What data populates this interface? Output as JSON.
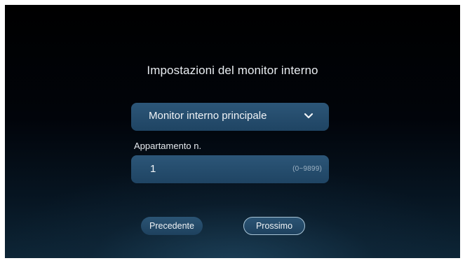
{
  "screen": {
    "title": "Impostazioni del monitor interno"
  },
  "monitor_type": {
    "selected": "Monitor interno principale",
    "icon": "chevron-down-icon"
  },
  "apartment": {
    "label": "Appartamento n.",
    "value": "1",
    "range_hint": "(0~9899)"
  },
  "navigation": {
    "prev_label": "Precedente",
    "next_label": "Prossimo"
  },
  "colors": {
    "field_bg": "#264d6e",
    "background": "#000000",
    "text": "#e9edf1",
    "next_border": "#a8c4d6"
  }
}
